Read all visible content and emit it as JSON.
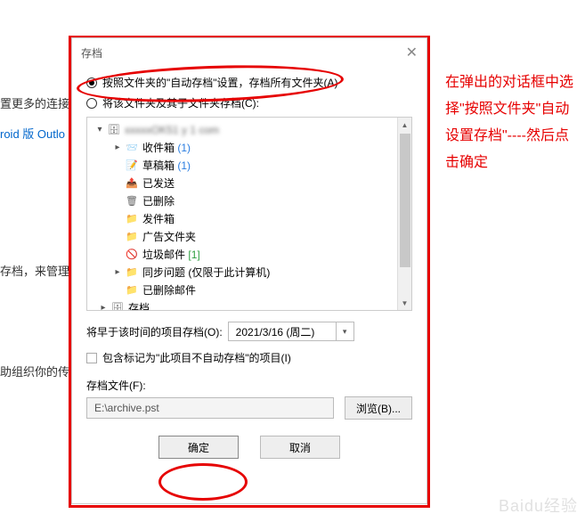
{
  "dialog": {
    "title": "存档",
    "close": "✕",
    "radio1": "按照文件夹的\"自动存档\"设置，存档所有文件夹(A)",
    "radio2": "将该文件夹及其子文件夹存档(C):",
    "date_label": "将早于该时间的项目存档(O):",
    "date_value": "2021/3/16 (周二)",
    "checkbox_label": "包含标记为\"此项目不自动存档\"的项目(I)",
    "file_label": "存档文件(F):",
    "file_path": "E:\\archive.pst",
    "browse": "浏览(B)...",
    "ok": "确定",
    "cancel": "取消"
  },
  "tree": {
    "root": "xxxxxOK51 y 1 com",
    "inbox": "收件箱",
    "inbox_count": "(1)",
    "drafts": "草稿箱",
    "drafts_count": "(1)",
    "sent": "已发送",
    "deleted": "已删除",
    "outbox": "发件箱",
    "ads": "广告文件夹",
    "junk": "垃圾邮件",
    "junk_count": "[1]",
    "sync": "同步问题 (仅限于此计算机)",
    "removed": "已删除邮件",
    "archive": "存档"
  },
  "bg": {
    "line1": "置更多的连接",
    "line2": "roid 版 Outlo",
    "line3": "存档，来管理",
    "line4": "助组织你的传"
  },
  "annotation": "在弹出的对话框中选择\"按照文件夹\"自动设置存档\"----然后点击确定",
  "watermark": "Baidu经验"
}
